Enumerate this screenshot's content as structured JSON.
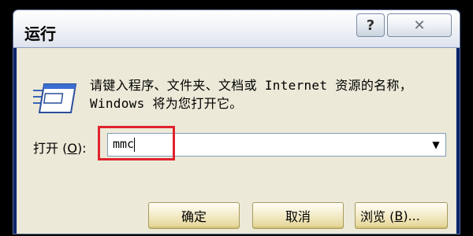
{
  "window": {
    "title": "运行"
  },
  "title_buttons": {
    "help_label": "?",
    "close_label": "✕"
  },
  "dialog": {
    "message": "请键入程序、文件夹、文档或 Internet 资源的名称，Windows 将为您打开它。",
    "open_label_prefix": "打开 (",
    "open_label_accel": "O",
    "open_label_suffix": "):",
    "command_value": "mmc",
    "dropdown_arrow": "▼"
  },
  "buttons": {
    "ok_label": "确定",
    "cancel_label": "取消",
    "browse_label_prefix": "浏览 (",
    "browse_label_accel": "B",
    "browse_label_suffix": ")..."
  },
  "colors": {
    "highlight": "#e0232e",
    "titlebar": "#ffffff",
    "dialog_bg": "#ece9d8",
    "button_face": "#f3ebc8"
  },
  "icons": {
    "run": "run-program-icon"
  }
}
